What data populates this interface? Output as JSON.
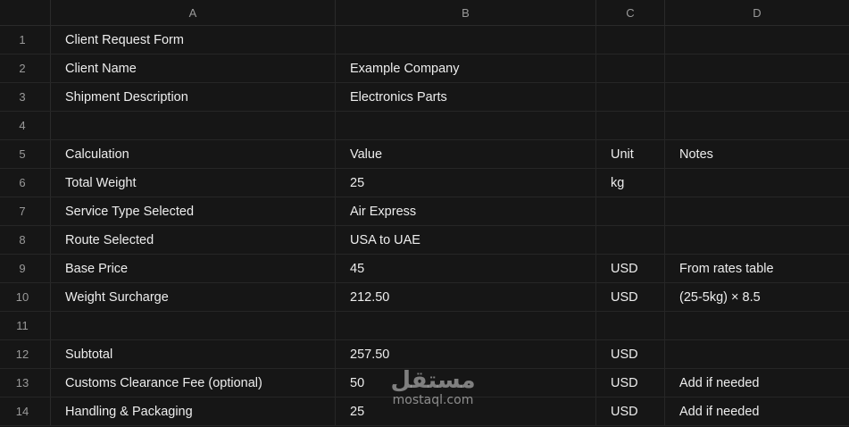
{
  "columns": [
    "A",
    "B",
    "C",
    "D"
  ],
  "rows": [
    {
      "num": "1",
      "a": "Client Request Form",
      "b": "",
      "c": "",
      "d": ""
    },
    {
      "num": "2",
      "a": "Client Name",
      "b": "Example Company",
      "c": "",
      "d": ""
    },
    {
      "num": "3",
      "a": "Shipment Description",
      "b": "Electronics Parts",
      "c": "",
      "d": ""
    },
    {
      "num": "4",
      "a": "",
      "b": "",
      "c": "",
      "d": ""
    },
    {
      "num": "5",
      "a": "Calculation",
      "b": "Value",
      "c": "Unit",
      "d": "Notes"
    },
    {
      "num": "6",
      "a": "Total Weight",
      "b": "25",
      "c": "kg",
      "d": ""
    },
    {
      "num": "7",
      "a": "Service Type Selected",
      "b": "Air Express",
      "c": "",
      "d": ""
    },
    {
      "num": "8",
      "a": "Route Selected",
      "b": "USA to UAE",
      "c": "",
      "d": ""
    },
    {
      "num": "9",
      "a": "Base Price",
      "b": "45",
      "c": "USD",
      "d": "From rates table"
    },
    {
      "num": "10",
      "a": "Weight Surcharge",
      "b": "212.50",
      "c": "USD",
      "d": "(25-5kg) × 8.5"
    },
    {
      "num": "11",
      "a": "",
      "b": "",
      "c": "",
      "d": ""
    },
    {
      "num": "12",
      "a": "Subtotal",
      "b": "257.50",
      "c": "USD",
      "d": ""
    },
    {
      "num": "13",
      "a": "Customs Clearance Fee (optional)",
      "b": "50",
      "c": "USD",
      "d": "Add if needed"
    },
    {
      "num": "14",
      "a": "Handling & Packaging",
      "b": "25",
      "c": "USD",
      "d": "Add if needed"
    }
  ],
  "watermark": {
    "logo_text": "مستقل",
    "url_text": "mostaql.com"
  }
}
